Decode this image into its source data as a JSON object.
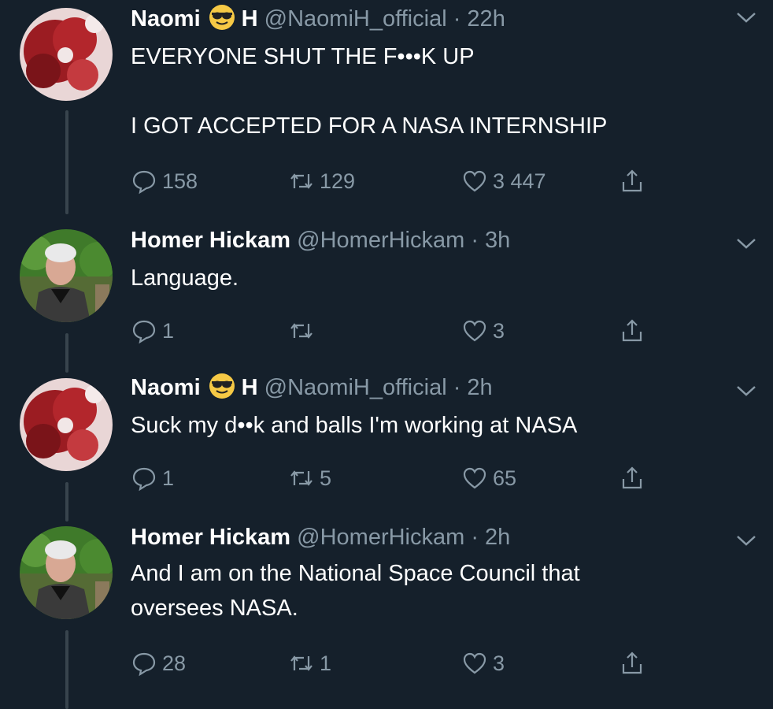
{
  "tweets": [
    {
      "name": "Naomi",
      "name_suffix": "H",
      "emoji": "sunglasses-face",
      "handle": "@NaomiH_official",
      "time": "· 22h",
      "text": "EVERYONE SHUT THE F•••K UP\n\nI GOT ACCEPTED FOR A NASA INTERNSHIP",
      "replies": "158",
      "retweets": "129",
      "likes": "3 447"
    },
    {
      "name": "Homer Hickam",
      "name_suffix": "",
      "emoji": "",
      "handle": "@HomerHickam",
      "time": "· 3h",
      "text": "Language.",
      "replies": "1",
      "retweets": "",
      "likes": "3"
    },
    {
      "name": "Naomi",
      "name_suffix": "H",
      "emoji": "sunglasses-face",
      "handle": "@NaomiH_official",
      "time": "· 2h",
      "text": "Suck my d••k and balls I'm working at NASA",
      "replies": "1",
      "retweets": "5",
      "likes": "65"
    },
    {
      "name": "Homer Hickam",
      "name_suffix": "",
      "emoji": "",
      "handle": "@HomerHickam",
      "time": "· 2h",
      "text": "And I am on the National Space Council that\noversees NASA.",
      "replies": "28",
      "retweets": "1",
      "likes": "3"
    }
  ],
  "colors": {
    "background": "#15202b",
    "secondary_text": "#8899a6",
    "thread_line": "#38444d"
  }
}
